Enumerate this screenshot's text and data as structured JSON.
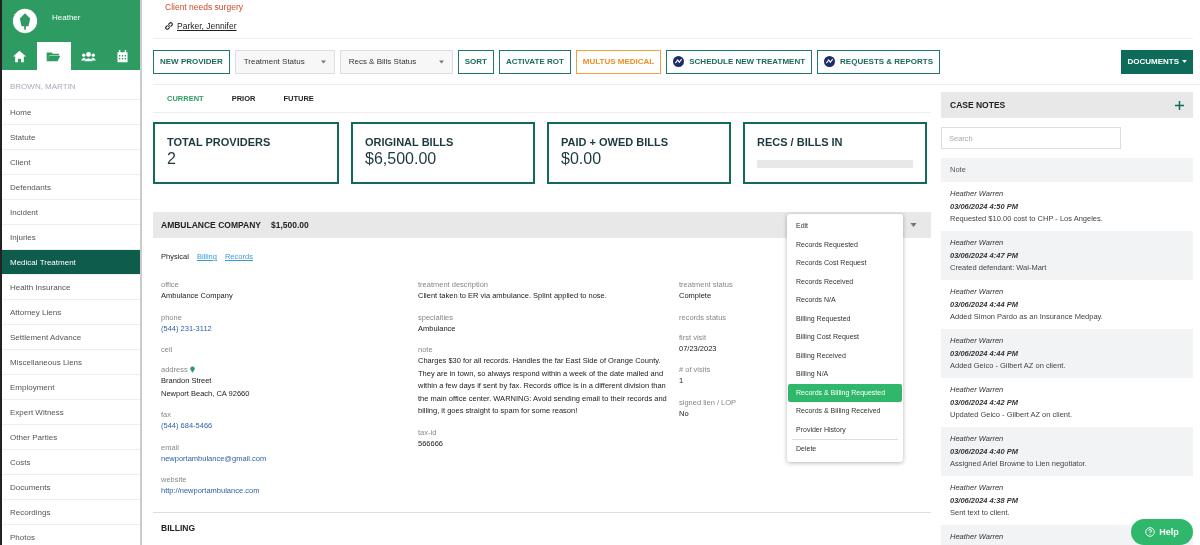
{
  "user": {
    "name": "Heather"
  },
  "nav_icons": [
    {
      "selected": false
    },
    {
      "selected": true
    },
    {
      "selected": false
    },
    {
      "selected": false
    }
  ],
  "client_name": "BROWN, MARTIN",
  "sidebar": {
    "items": [
      {
        "label": "Home",
        "selected": false
      },
      {
        "label": "Statute",
        "selected": false
      },
      {
        "label": "Client",
        "selected": false
      },
      {
        "label": "Defendants",
        "selected": false
      },
      {
        "label": "Incident",
        "selected": false
      },
      {
        "label": "Injuries",
        "selected": false
      },
      {
        "label": "Medical Treatment",
        "selected": true
      },
      {
        "label": "Health Insurance",
        "selected": false
      },
      {
        "label": "Attorney Liens",
        "selected": false
      },
      {
        "label": "Settlement Advance",
        "selected": false
      },
      {
        "label": "Miscellaneous Liens",
        "selected": false
      },
      {
        "label": "Employment",
        "selected": false
      },
      {
        "label": "Expert Witness",
        "selected": false
      },
      {
        "label": "Other Parties",
        "selected": false
      },
      {
        "label": "Costs",
        "selected": false
      },
      {
        "label": "Documents",
        "selected": false
      },
      {
        "label": "Recordings",
        "selected": false
      },
      {
        "label": "Photos",
        "selected": false
      }
    ]
  },
  "alert": "Client needs surgery",
  "linked_case": "Parker, Jennifer",
  "toolbar": [
    {
      "kind": "outline",
      "label": "NEW PROVIDER"
    },
    {
      "kind": "select",
      "label": "Treatment Status"
    },
    {
      "kind": "select",
      "label": "Recs & Bills Status"
    },
    {
      "kind": "outline",
      "label": "SORT"
    },
    {
      "kind": "outline",
      "label": "ACTIVATE ROT"
    },
    {
      "kind": "orange",
      "label": "MULTUS MEDICAL"
    },
    {
      "kind": "icon",
      "label": "SCHEDULE NEW TREATMENT"
    },
    {
      "kind": "icon",
      "label": "REQUESTS & REPORTS"
    }
  ],
  "documents_button": "DOCUMENTS",
  "tabs": [
    {
      "label": "CURRENT",
      "selected": true
    },
    {
      "label": "PRIOR",
      "selected": false
    },
    {
      "label": "FUTURE",
      "selected": false
    }
  ],
  "stats": [
    {
      "title": "TOTAL PROVIDERS",
      "value": "2"
    },
    {
      "title": "ORIGINAL BILLS",
      "value": "$6,500.00"
    },
    {
      "title": "PAID + OWED BILLS",
      "value": "$0.00"
    },
    {
      "title": "RECS / BILLS IN",
      "kind": "meter"
    }
  ],
  "provider": {
    "name": "AMBULANCE COMPANY",
    "amount": "$1,500.00",
    "links": [
      {
        "label": "Physical",
        "selected": true
      },
      {
        "label": "Billing",
        "selected": false
      },
      {
        "label": "Records",
        "selected": false
      }
    ],
    "columns": [
      [
        {
          "label": "office",
          "kind": "text",
          "values": [
            "Ambulance Company"
          ]
        },
        {
          "label": "phone",
          "kind": "link",
          "values": [
            "(544) 231-3112"
          ]
        },
        {
          "label": "cell",
          "kind": "text"
        },
        {
          "label": "address",
          "kind": "address",
          "values": [
            "Brandon Street",
            "Newport Beach, CA 92660"
          ]
        },
        {
          "label": "fax",
          "kind": "link",
          "values": [
            "(544) 684-5466"
          ]
        },
        {
          "label": "email",
          "kind": "link",
          "values": [
            "newportambulance@gmail.com"
          ]
        },
        {
          "label": "website",
          "kind": "link",
          "values": [
            "http://newportambulance.com"
          ]
        }
      ],
      [
        {
          "label": "treatment description",
          "kind": "text",
          "values": [
            "Client taken to ER via ambulance. Splint applied to nose."
          ]
        },
        {
          "label": "specialties",
          "kind": "text",
          "values": [
            "Ambulance"
          ]
        },
        {
          "label": "note",
          "kind": "text",
          "values": [
            "Charges $30 for all records. Handles the far East Side of Orange County. They are in town, so always respond within a week of the date mailed and within a few days if sent by fax. Records office is in a different division than the main office center. WARNING: Avoid sending email to their records and billing, it goes straight to spam for some reason!"
          ]
        },
        {
          "label": "tax-id",
          "kind": "text",
          "values": [
            "566666"
          ]
        }
      ],
      [
        {
          "label": "treatment status",
          "kind": "text",
          "values": [
            "Complete"
          ]
        },
        {
          "label": "records status",
          "kind": "text"
        },
        {
          "label": "first visit",
          "kind": "text",
          "values": [
            "07/23/2023"
          ]
        },
        {
          "label": "# of visits",
          "kind": "text",
          "values": [
            "1"
          ]
        },
        {
          "label": "signed lien / LOP",
          "kind": "text",
          "values": [
            "No"
          ]
        }
      ]
    ]
  },
  "menu": [
    {
      "label": "Edit",
      "selected": false
    },
    {
      "label": "Records Requested",
      "selected": false
    },
    {
      "label": "Records Cost Request",
      "selected": false
    },
    {
      "label": "Records Received",
      "selected": false
    },
    {
      "label": "Records N/A",
      "selected": false
    },
    {
      "label": "Billing Requested",
      "selected": false
    },
    {
      "label": "Billing Cost Request",
      "selected": false
    },
    {
      "label": "Billing Received",
      "selected": false
    },
    {
      "label": "Billing N/A",
      "selected": false
    },
    {
      "label": "Records & Billing Requested",
      "selected": true
    },
    {
      "label": "Records & Billing Received",
      "selected": false
    },
    {
      "label": "Provider History",
      "selected": false
    },
    {
      "label": "Delete",
      "selected": false,
      "separated": true
    }
  ],
  "next_section": "BILLING",
  "case_notes": {
    "title": "CASE NOTES",
    "search": {
      "placeholder": "Search"
    },
    "column": "Note",
    "notes": [
      {
        "author": "Heather Warren",
        "time": "03/06/2024 4:50 PM",
        "text": "Requested $10.00 cost to CHP - Los Angeles."
      },
      {
        "author": "Heather Warren",
        "time": "03/06/2024 4:47 PM",
        "text": "Created defendant: Wal-Mart"
      },
      {
        "author": "Heather Warren",
        "time": "03/06/2024 4:44 PM",
        "text": "Added Simon Pardo as an Insurance Medpay."
      },
      {
        "author": "Heather Warren",
        "time": "03/06/2024 4:44 PM",
        "text": "Added Geico - Gilbert AZ on client."
      },
      {
        "author": "Heather Warren",
        "time": "03/06/2024 4:42 PM",
        "text": "Updated Geico - Gilbert AZ on client."
      },
      {
        "author": "Heather Warren",
        "time": "03/06/2024 4:40 PM",
        "text": "Assigned Ariel Browne to Lien negotiator."
      },
      {
        "author": "Heather Warren",
        "time": "03/06/2024 4:38 PM",
        "text": "Sent text to client."
      },
      {
        "author": "Heather Warren"
      }
    ]
  },
  "help_button": "Help"
}
